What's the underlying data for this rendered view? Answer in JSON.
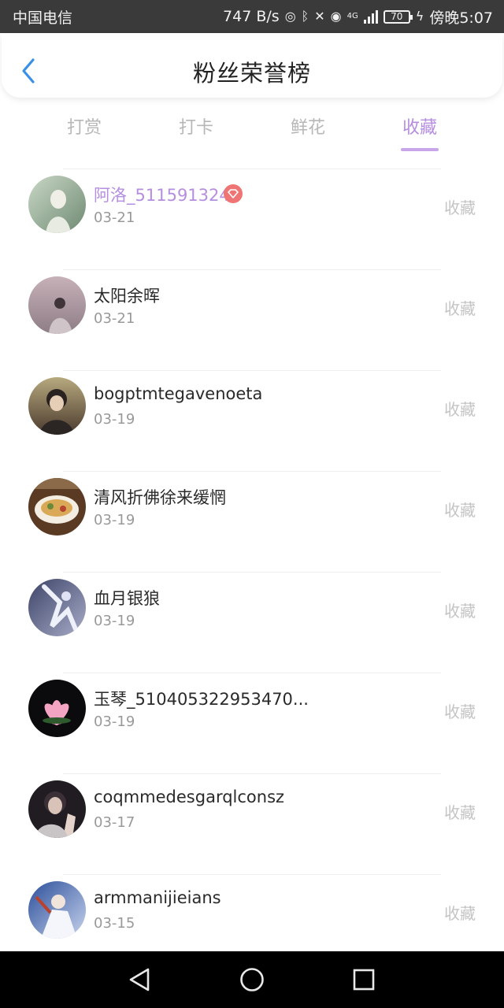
{
  "status_bar": {
    "carrier": "中国电信",
    "speed": "747 B/s",
    "network": "4G",
    "battery": "70",
    "time": "傍晚5:07"
  },
  "header": {
    "title": "粉丝荣誉榜"
  },
  "tabs": [
    {
      "label": "打赏",
      "active": false
    },
    {
      "label": "打卡",
      "active": false
    },
    {
      "label": "鲜花",
      "active": false
    },
    {
      "label": "收藏",
      "active": true
    }
  ],
  "fans": [
    {
      "name": "阿洛_511591324",
      "date": "03-21",
      "action": "收藏",
      "vip": true
    },
    {
      "name": "太阳余晖",
      "date": "03-21",
      "action": "收藏",
      "vip": false
    },
    {
      "name": "bogptmtegavenoeta",
      "date": "03-19",
      "action": "收藏",
      "vip": false
    },
    {
      "name": "清风折佛徐来缓惘",
      "date": "03-19",
      "action": "收藏",
      "vip": false
    },
    {
      "name": "血月银狼",
      "date": "03-19",
      "action": "收藏",
      "vip": false
    },
    {
      "name": "玉琴_510405322953470...",
      "date": "03-19",
      "action": "收藏",
      "vip": false
    },
    {
      "name": "coqmmedesgarqlconsz",
      "date": "03-17",
      "action": "收藏",
      "vip": false
    },
    {
      "name": "armmanijieians",
      "date": "03-15",
      "action": "收藏",
      "vip": false
    }
  ],
  "colors": {
    "accent": "#b68ee0",
    "vip_badge": "#ef7474",
    "muted": "#999999"
  }
}
